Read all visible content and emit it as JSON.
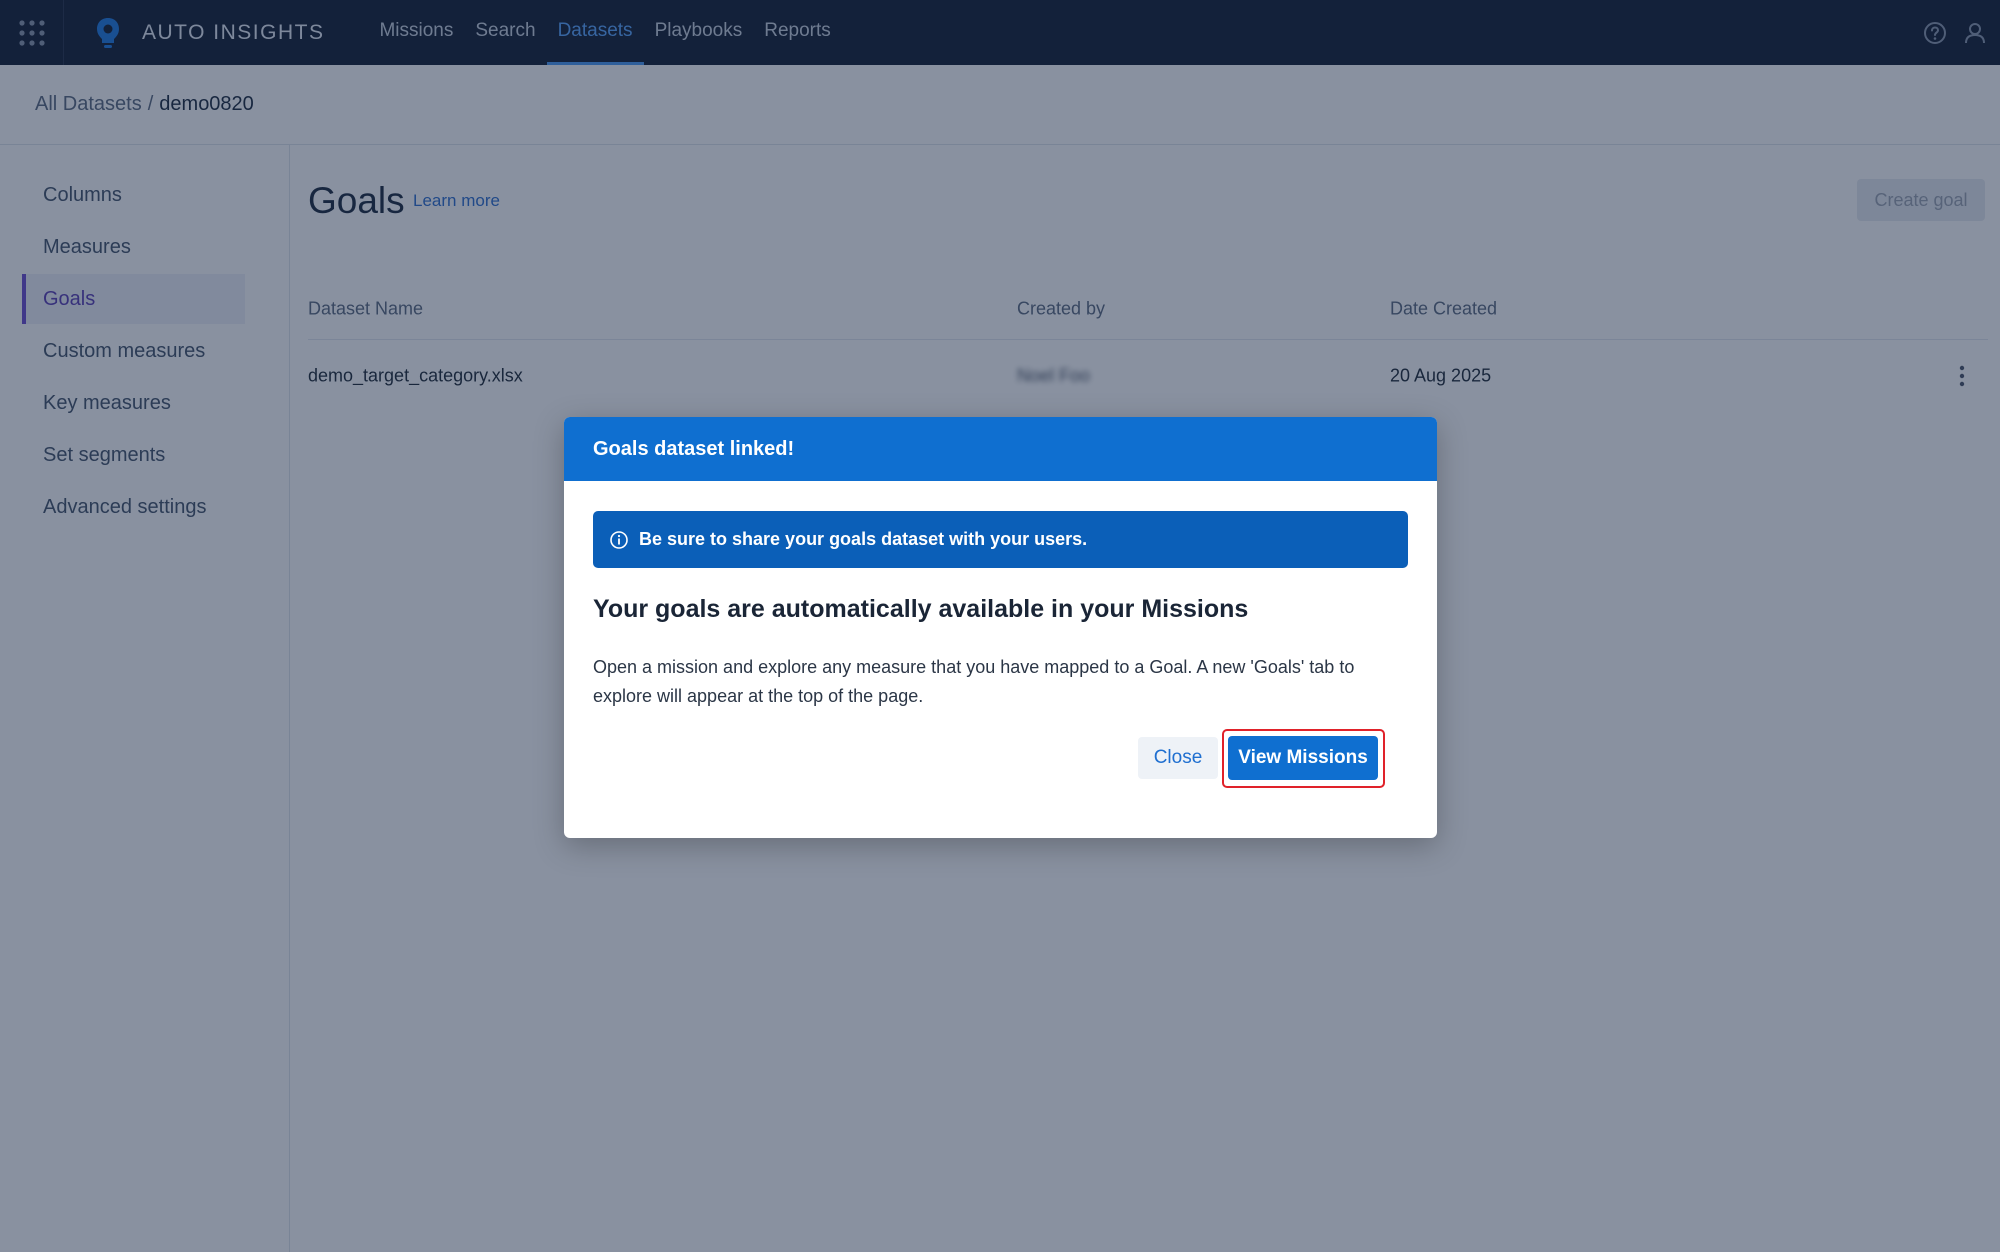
{
  "app": {
    "name": "AUTO INSIGHTS",
    "colors": {
      "topbar": "#131e33",
      "accent": "#0f6fd0",
      "active_nav": "#5aa7ff",
      "sidebar_active": "#6c4cd0",
      "highlight": "#e0222a"
    }
  },
  "topnav": {
    "items": [
      {
        "label": "Missions",
        "active": false
      },
      {
        "label": "Search",
        "active": false
      },
      {
        "label": "Datasets",
        "active": true
      },
      {
        "label": "Playbooks",
        "active": false
      },
      {
        "label": "Reports",
        "active": false
      }
    ],
    "icons": [
      "apps-grid-icon",
      "lightbulb-logo-icon",
      "help-icon",
      "user-icon"
    ]
  },
  "breadcrumb": {
    "parent": "All Datasets",
    "separator": "/",
    "current": "demo0820"
  },
  "sidebar": {
    "items": [
      {
        "label": "Columns",
        "active": false
      },
      {
        "label": "Measures",
        "active": false
      },
      {
        "label": "Goals",
        "active": true
      },
      {
        "label": "Custom measures",
        "active": false
      },
      {
        "label": "Key measures",
        "active": false
      },
      {
        "label": "Set segments",
        "active": false
      },
      {
        "label": "Advanced settings",
        "active": false
      }
    ]
  },
  "main": {
    "title": "Goals",
    "learn_more": "Learn more",
    "create_goal": "Create goal",
    "table": {
      "columns": [
        "Dataset Name",
        "Created by",
        "Date Created"
      ],
      "rows": [
        {
          "dataset_name": "demo_target_category.xlsx",
          "created_by": "Noel Foo",
          "date_created": "20 Aug 2025"
        }
      ]
    }
  },
  "modal": {
    "title": "Goals dataset linked!",
    "banner": "Be sure to share your goals dataset with your users.",
    "heading": "Your goals are automatically available in your Missions",
    "body": "Open a mission and explore any measure that you have mapped to a Goal. A new 'Goals' tab to explore will appear at the top of the page.",
    "close_label": "Close",
    "view_label": "View Missions"
  }
}
